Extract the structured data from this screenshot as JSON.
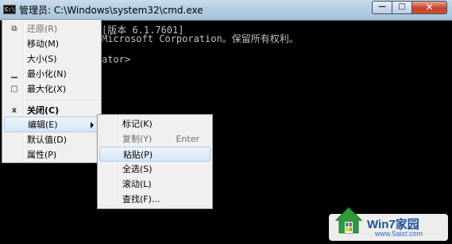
{
  "window": {
    "title": "管理员: C:\\Windows\\system32\\cmd.exe",
    "icon_text": "C:\\",
    "controls": {
      "minimize": "—",
      "maximize": "□",
      "close": "✕"
    }
  },
  "console": {
    "lines": [
      "[版本 6.1.7601]",
      "Microsoft Corporation。保留所有权利。",
      "ator>"
    ]
  },
  "system_menu": {
    "items": [
      {
        "label": "还原(R)",
        "icon": "restore-icon",
        "glyph": "⧉"
      },
      {
        "label": "移动(M)"
      },
      {
        "label": "大小(S)"
      },
      {
        "label": "最小化(N)",
        "icon": "minimize-icon",
        "glyph": "▁"
      },
      {
        "label": "最大化(X)",
        "icon": "maximize-icon",
        "glyph": "□"
      },
      {
        "label": "关闭(C)",
        "icon": "close-icon",
        "glyph": "x"
      },
      {
        "label": "编辑(E)"
      },
      {
        "label": "默认值(D)"
      },
      {
        "label": "属性(P)"
      }
    ]
  },
  "edit_submenu": {
    "items": [
      {
        "label": "标记(K)"
      },
      {
        "label": "复制(Y)",
        "shortcut": "Enter"
      },
      {
        "label": "粘贴(P)"
      },
      {
        "label": "全选(S)"
      },
      {
        "label": "滚动(L)"
      },
      {
        "label": "查找(F)..."
      }
    ]
  },
  "watermark": {
    "line1": "Win7家园",
    "line2": "www.5aixt.com"
  },
  "colors": {
    "console_bg": "#000000",
    "console_text": "#c0c0c0",
    "menu_bg": "#f0f0f0",
    "hover": "#d6e6f7",
    "close_red": "#c5442a"
  }
}
